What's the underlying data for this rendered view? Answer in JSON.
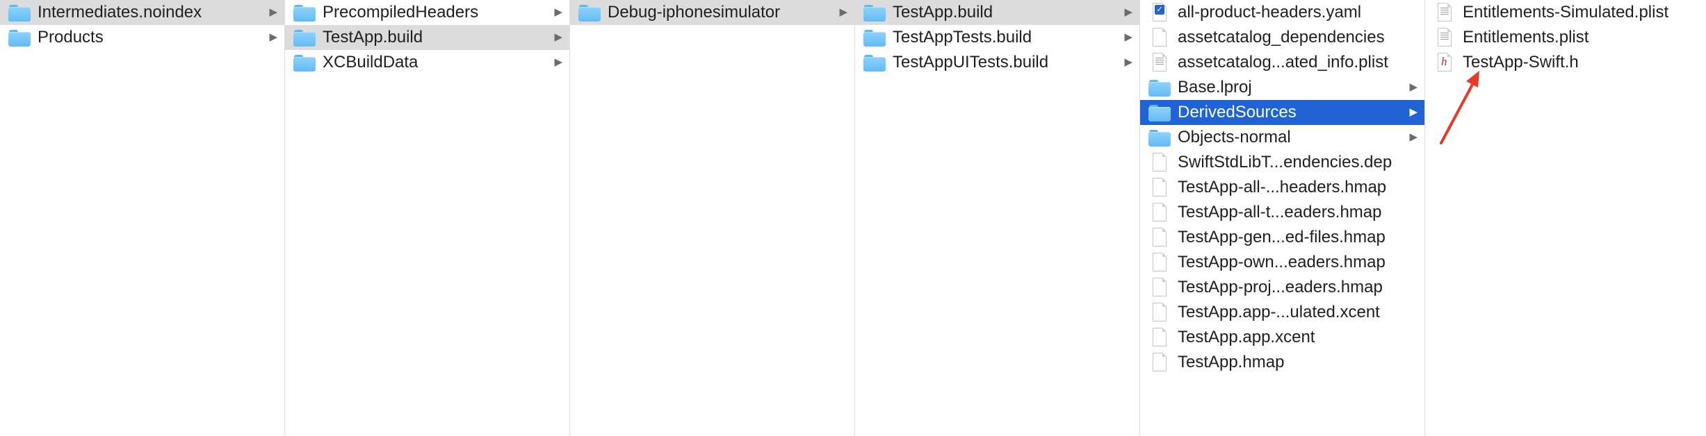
{
  "columns": [
    {
      "items": [
        {
          "label": "Intermediates.noindex",
          "icon": "folder-icon",
          "chevron": true,
          "state": "grey"
        },
        {
          "label": "Products",
          "icon": "folder-icon",
          "chevron": true,
          "state": "none"
        }
      ]
    },
    {
      "items": [
        {
          "label": "PrecompiledHeaders",
          "icon": "folder-icon",
          "chevron": true,
          "state": "none"
        },
        {
          "label": "TestApp.build",
          "icon": "folder-icon",
          "chevron": true,
          "state": "grey"
        },
        {
          "label": "XCBuildData",
          "icon": "folder-icon",
          "chevron": true,
          "state": "none"
        }
      ]
    },
    {
      "items": [
        {
          "label": "Debug-iphonesimulator",
          "icon": "folder-icon",
          "chevron": true,
          "state": "grey"
        }
      ]
    },
    {
      "items": [
        {
          "label": "TestApp.build",
          "icon": "folder-icon",
          "chevron": true,
          "state": "grey"
        },
        {
          "label": "TestAppTests.build",
          "icon": "folder-icon",
          "chevron": true,
          "state": "none"
        },
        {
          "label": "TestAppUITests.build",
          "icon": "folder-icon",
          "chevron": true,
          "state": "none"
        }
      ]
    },
    {
      "items": [
        {
          "label": "all-product-headers.yaml",
          "icon": "yaml-file-icon",
          "chevron": false,
          "state": "none"
        },
        {
          "label": "assetcatalog_dependencies",
          "icon": "document-icon",
          "chevron": false,
          "state": "none"
        },
        {
          "label": "assetcatalog...ated_info.plist",
          "icon": "plist-file-icon",
          "chevron": false,
          "state": "none"
        },
        {
          "label": "Base.lproj",
          "icon": "folder-icon",
          "chevron": true,
          "state": "none"
        },
        {
          "label": "DerivedSources",
          "icon": "folder-icon",
          "chevron": true,
          "state": "blue"
        },
        {
          "label": "Objects-normal",
          "icon": "folder-icon",
          "chevron": true,
          "state": "none"
        },
        {
          "label": "SwiftStdLibT...endencies.dep",
          "icon": "document-icon",
          "chevron": false,
          "state": "none"
        },
        {
          "label": "TestApp-all-...headers.hmap",
          "icon": "document-icon",
          "chevron": false,
          "state": "none"
        },
        {
          "label": "TestApp-all-t...eaders.hmap",
          "icon": "document-icon",
          "chevron": false,
          "state": "none"
        },
        {
          "label": "TestApp-gen...ed-files.hmap",
          "icon": "document-icon",
          "chevron": false,
          "state": "none"
        },
        {
          "label": "TestApp-own...eaders.hmap",
          "icon": "document-icon",
          "chevron": false,
          "state": "none"
        },
        {
          "label": "TestApp-proj...eaders.hmap",
          "icon": "document-icon",
          "chevron": false,
          "state": "none"
        },
        {
          "label": "TestApp.app-...ulated.xcent",
          "icon": "document-icon",
          "chevron": false,
          "state": "none"
        },
        {
          "label": "TestApp.app.xcent",
          "icon": "document-icon",
          "chevron": false,
          "state": "none"
        },
        {
          "label": "TestApp.hmap",
          "icon": "document-icon",
          "chevron": false,
          "state": "none"
        }
      ]
    },
    {
      "items": [
        {
          "label": "Entitlements-Simulated.plist",
          "icon": "plist-file-icon",
          "chevron": false,
          "state": "none"
        },
        {
          "label": "Entitlements.plist",
          "icon": "plist-file-icon",
          "chevron": false,
          "state": "none"
        },
        {
          "label": "TestApp-Swift.h",
          "icon": "header-file-icon",
          "chevron": false,
          "state": "none"
        }
      ]
    }
  ],
  "chevron_glyph": "▶",
  "header_glyph": "h",
  "yaml_glyph": "✓",
  "annotation": {
    "color": "#e8382a",
    "icon": "red-arrow-icon"
  },
  "colors": {
    "selection_blue": "#1f63d6",
    "selection_grey": "#dcdcdc"
  }
}
